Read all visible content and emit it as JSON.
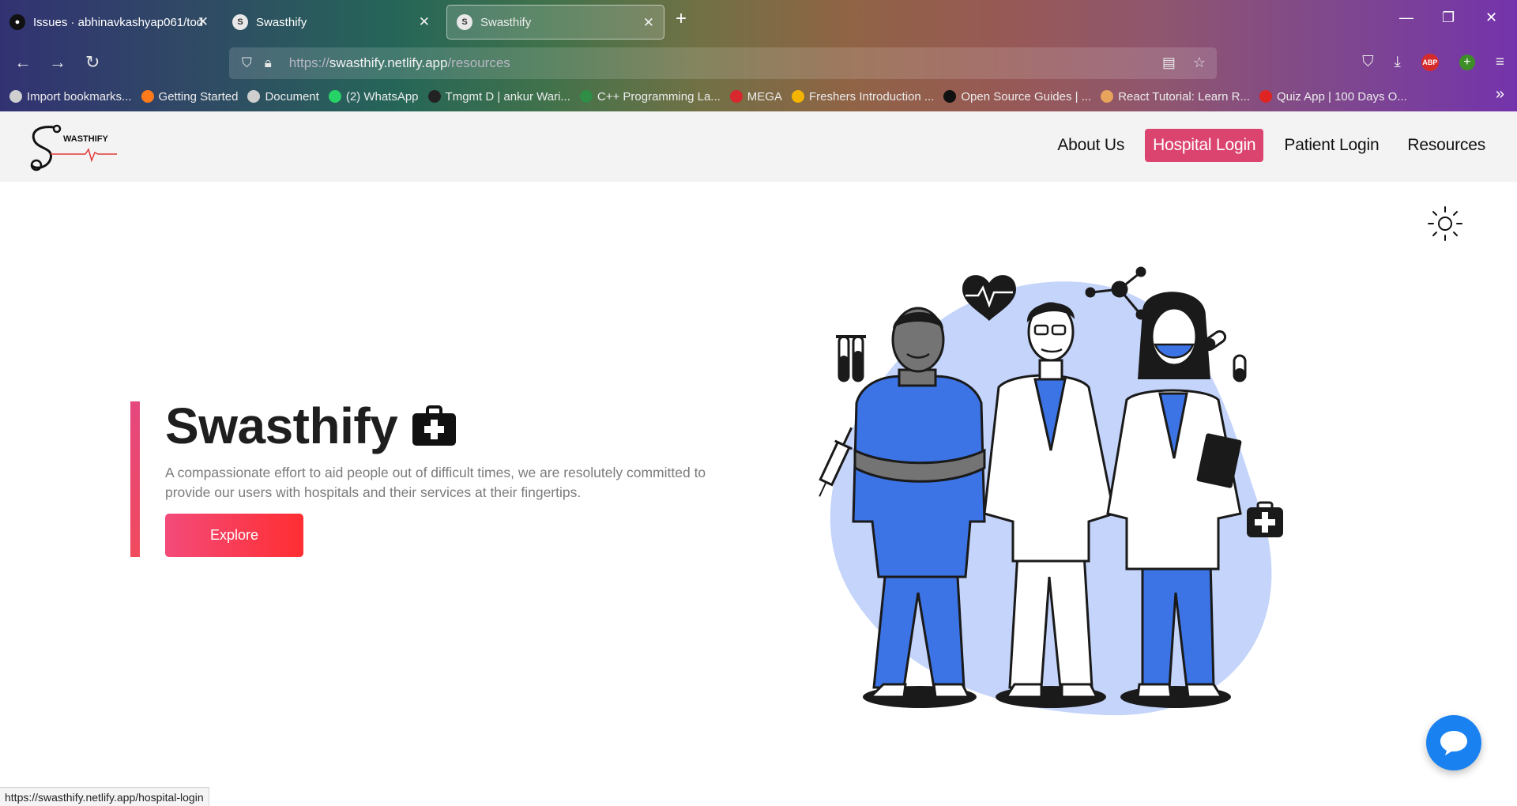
{
  "browser": {
    "tabs": [
      {
        "title": "Issues · abhinavkashyap061/tod",
        "icon": "github-icon"
      },
      {
        "title": "Swasthify",
        "icon": "swasthify-favicon"
      },
      {
        "title": "Swasthify",
        "icon": "swasthify-favicon",
        "active": true
      }
    ],
    "url": {
      "protocol": "https://",
      "host": "swasthify.netlify.app",
      "path": "/resources"
    },
    "bookmarks": [
      {
        "label": "Import bookmarks...",
        "color": "#cfcfcf"
      },
      {
        "label": "Getting Started",
        "color": "#ff7a1a"
      },
      {
        "label": "Document",
        "color": "#cfcfcf"
      },
      {
        "label": "(2) WhatsApp",
        "color": "#25d366"
      },
      {
        "label": "Tmgmt D | ankur Wari...",
        "color": "#222222"
      },
      {
        "label": "C++ Programming La...",
        "color": "#2f8d46"
      },
      {
        "label": "MEGA",
        "color": "#d9272e"
      },
      {
        "label": "Freshers Introduction ...",
        "color": "#f4b400"
      },
      {
        "label": "Open Source Guides | ...",
        "color": "#111111"
      },
      {
        "label": "React Tutorial: Learn R...",
        "color": "#e8a35c"
      },
      {
        "label": "Quiz App | 100 Days O...",
        "color": "#e02424"
      }
    ],
    "status_url": "https://swasthify.netlify.app/hospital-login"
  },
  "header": {
    "logo_text": "WASTHIFY",
    "nav": [
      {
        "label": "About Us",
        "active": false
      },
      {
        "label": "Hospital Login",
        "active": true
      },
      {
        "label": "Patient Login",
        "active": false
      },
      {
        "label": "Resources",
        "active": false
      }
    ]
  },
  "hero": {
    "title": "Swasthify",
    "description": "A compassionate effort to aid people out of difficult times, we are resolutely committed to provide our users with hospitals and their services at their fingertips.",
    "button_label": "Explore"
  },
  "colors": {
    "accent": "#dc4470",
    "button_gradient": [
      "#f34b7a",
      "#ff2e32"
    ],
    "illustration_blob": "#c4d4fa",
    "scrubs_blue": "#3c74e6",
    "chat_button": "#1a82f0"
  }
}
